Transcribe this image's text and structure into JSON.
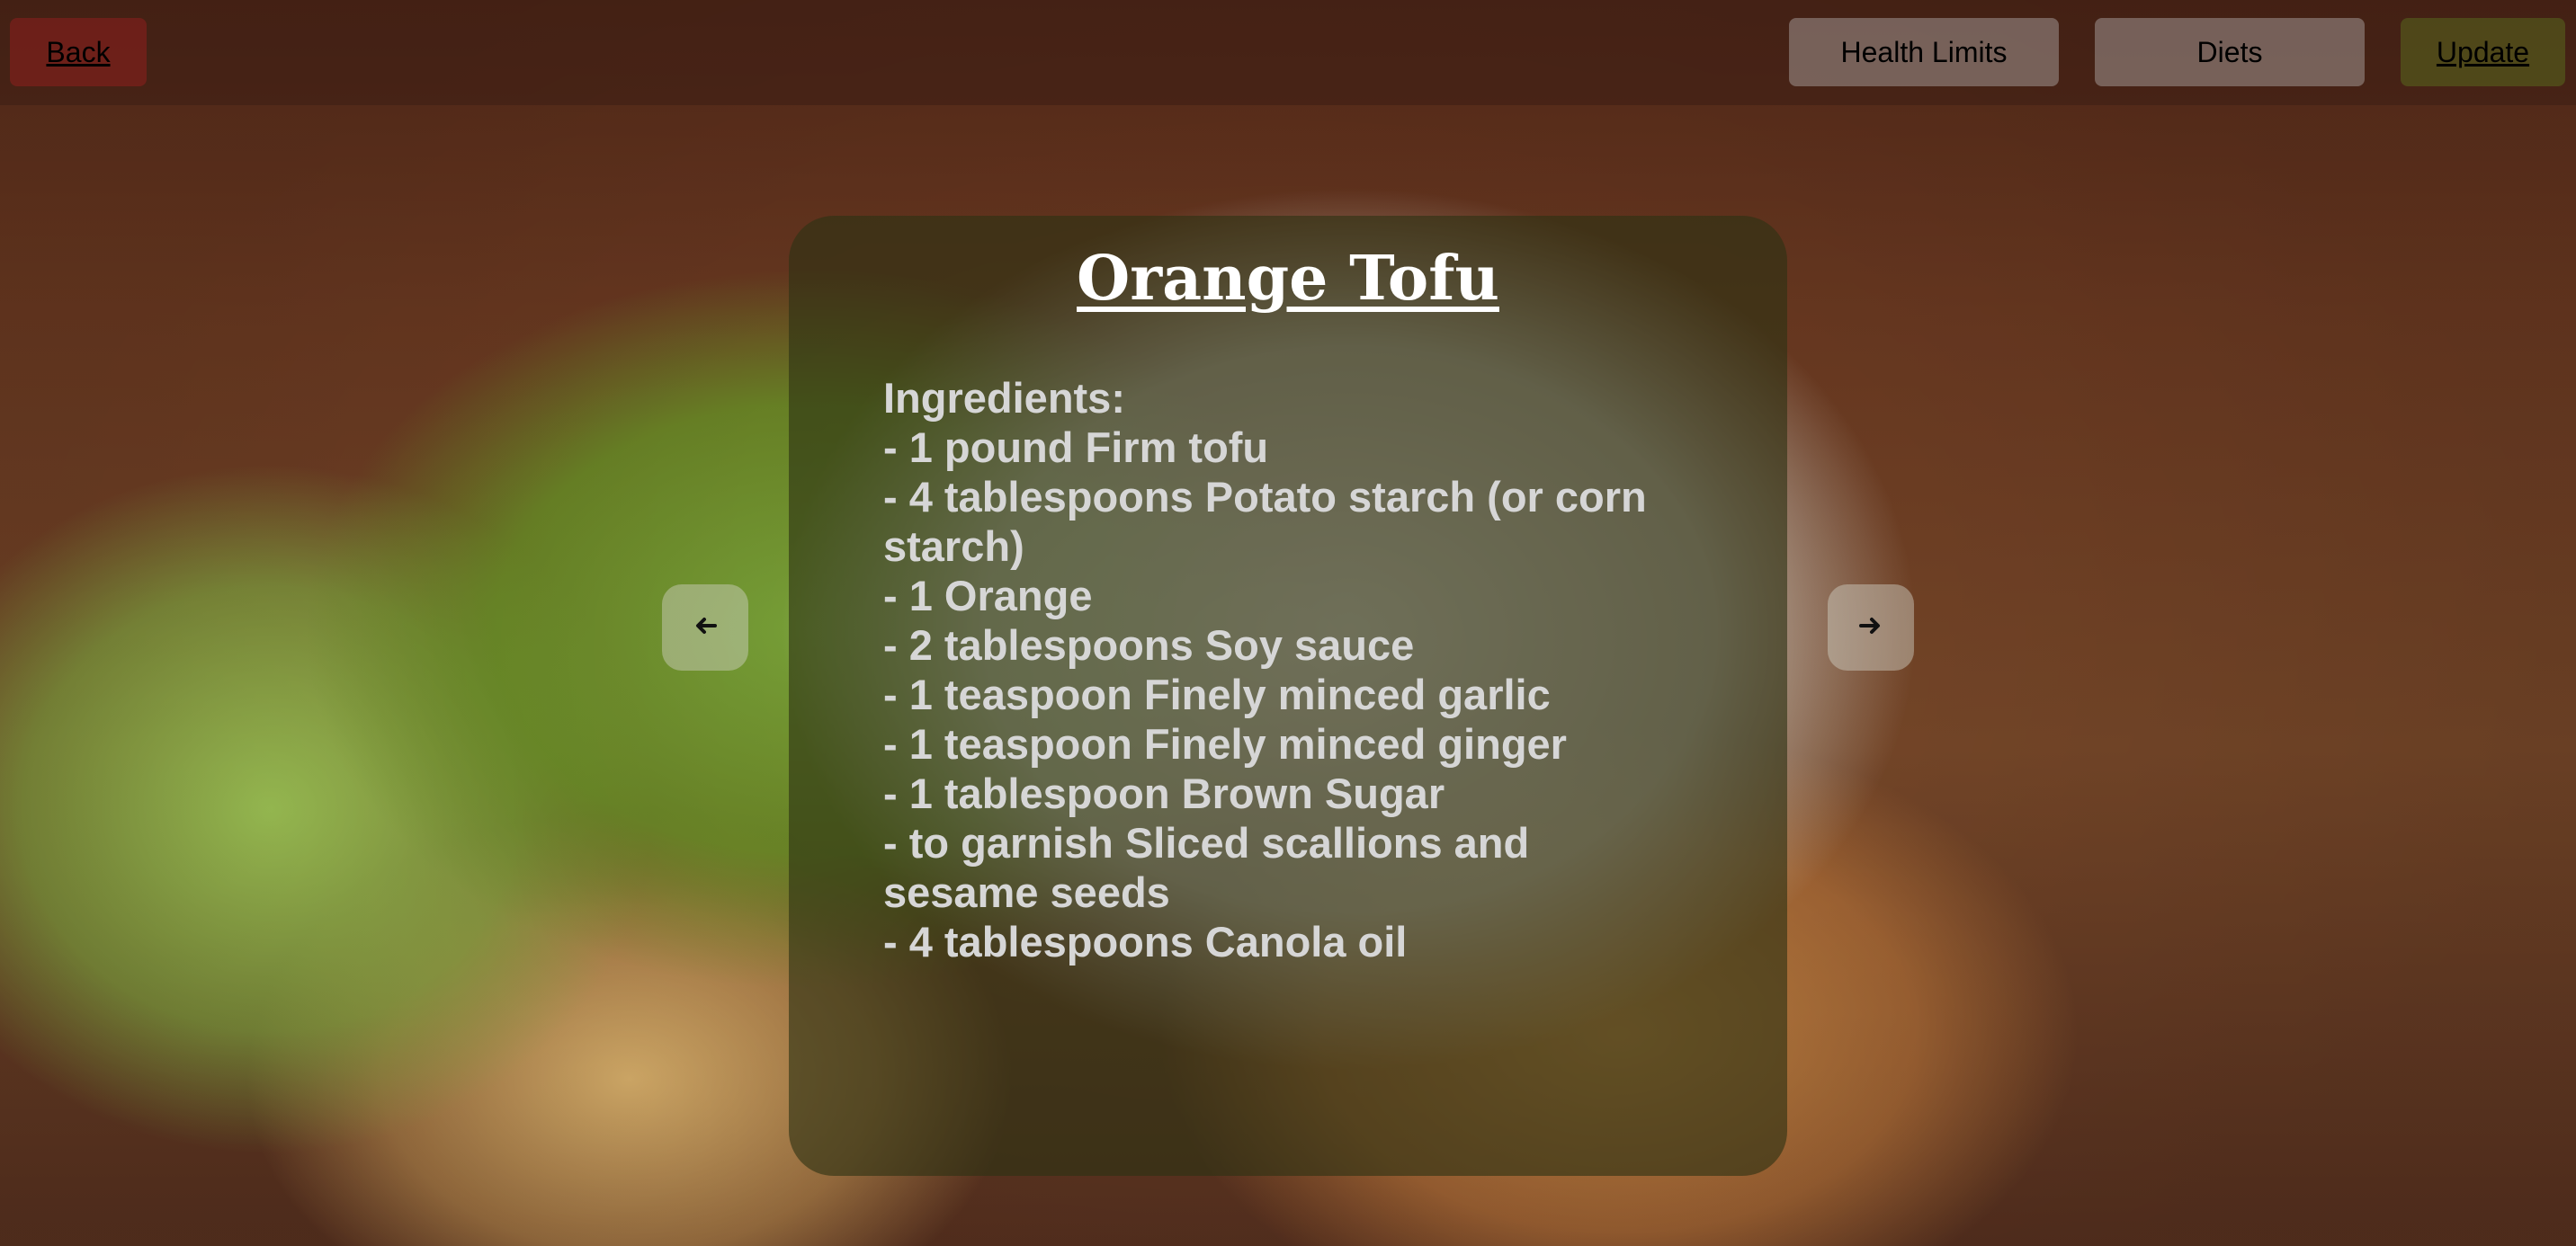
{
  "topbar": {
    "back_label": "Back",
    "health_limits_label": "Health Limits",
    "diets_label": "Diets",
    "update_label": "Update"
  },
  "recipe": {
    "title": "Orange Tofu",
    "ingredients_heading": "Ingredients:",
    "ingredients": [
      "- 1 pound Firm tofu",
      "- 4 tablespoons Potato starch (or corn starch)",
      "- 1 Orange",
      "- 2 tablespoons Soy sauce",
      "- 1 teaspoon Finely minced garlic",
      "- 1 teaspoon Finely minced ginger",
      "- 1 tablespoon Brown Sugar",
      "- to garnish Sliced scallions and sesame seeds",
      "- 4 tablespoons Canola oil"
    ]
  },
  "nav": {
    "prev_icon": "arrow-left-icon",
    "next_icon": "arrow-right-icon"
  }
}
